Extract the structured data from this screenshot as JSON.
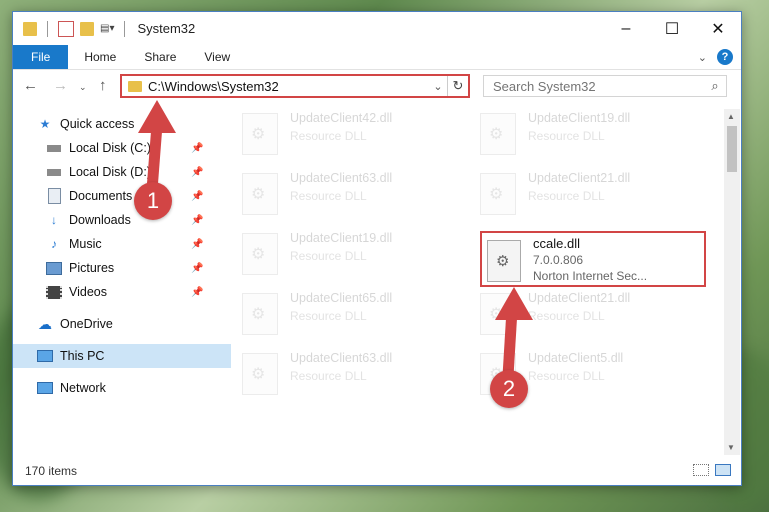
{
  "window": {
    "title": "System32",
    "controls": {
      "minimize": "–",
      "maximize": "☐",
      "close": "✕"
    }
  },
  "ribbon": {
    "tabs": [
      "File",
      "Home",
      "Share",
      "View"
    ],
    "help": "?"
  },
  "address": {
    "path": "C:\\Windows\\System32",
    "search_placeholder": "Search System32"
  },
  "nav": {
    "items": [
      {
        "label": "Quick access",
        "icon": "star-icon"
      },
      {
        "label": "Local Disk (C:)",
        "icon": "drive-icon",
        "pinned": true
      },
      {
        "label": "Local Disk (D:)",
        "icon": "drive-icon",
        "pinned": true
      },
      {
        "label": "Documents",
        "icon": "documents-icon",
        "pinned": true
      },
      {
        "label": "Downloads",
        "icon": "downloads-icon",
        "pinned": true
      },
      {
        "label": "Music",
        "icon": "music-icon",
        "pinned": true
      },
      {
        "label": "Pictures",
        "icon": "pictures-icon",
        "pinned": true
      },
      {
        "label": "Videos",
        "icon": "videos-icon",
        "pinned": true
      },
      {
        "label": "OneDrive",
        "icon": "onedrive-icon"
      },
      {
        "label": "This PC",
        "icon": "pc-icon",
        "selected": true
      },
      {
        "label": "Network",
        "icon": "network-icon"
      }
    ]
  },
  "files": [
    {
      "name": "UpdateClient42.dll",
      "type": "Resource DLL"
    },
    {
      "name": "UpdateClient19.dll",
      "type": "Resource DLL"
    },
    {
      "name": "UpdateClient63.dll",
      "type": "Resource DLL"
    },
    {
      "name": "UpdateClient21.dll",
      "type": "Resource DLL"
    },
    {
      "name": "UpdateClient19.dll",
      "type": "Resource DLL"
    },
    {
      "name": "UpdateClient65.dll",
      "type": "Resource DLL"
    },
    {
      "name": "UpdateClient21.dll",
      "type": "Resource DLL"
    },
    {
      "name": "UpdateClient63.dll",
      "type": "Resource DLL"
    },
    {
      "name": "UpdateClient5.dll",
      "type": "Resource DLL"
    }
  ],
  "highlighted_file": {
    "name": "ccale.dll",
    "version": "7.0.0.806",
    "description": "Norton Internet Sec..."
  },
  "status": {
    "item_count": "170 items"
  },
  "annotations": {
    "step1": "1",
    "step2": "2",
    "color": "#d24545"
  }
}
